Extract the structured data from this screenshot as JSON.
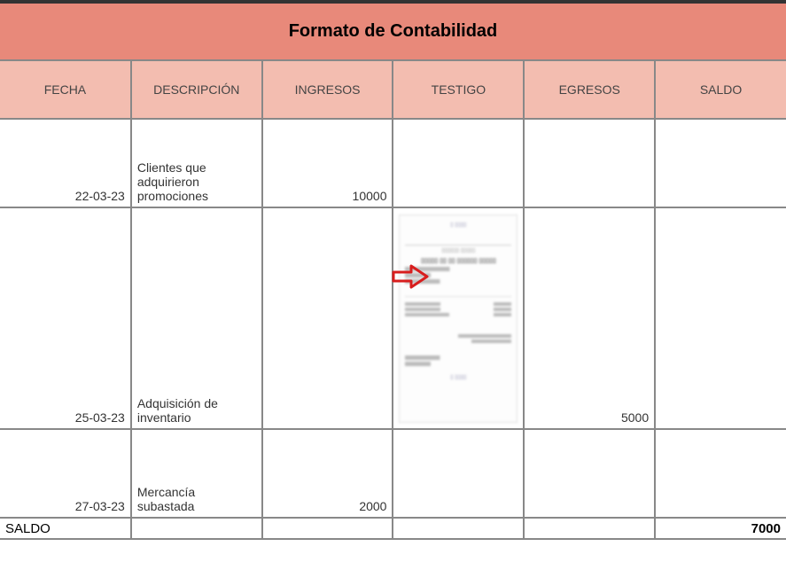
{
  "title": "Formato de Contabilidad",
  "headers": {
    "fecha": "FECHA",
    "descripcion": "DESCRIPCIÓN",
    "ingresos": "INGRESOS",
    "testigo": "TESTIGO",
    "egresos": "EGRESOS",
    "saldo": "SALDO"
  },
  "rows": [
    {
      "fecha": "22-03-23",
      "descripcion": "Clientes que adquirieron promociones",
      "ingresos": "10000",
      "testigo": "",
      "egresos": "",
      "saldo": ""
    },
    {
      "fecha": "25-03-23",
      "descripcion": "Adquisición de inventario",
      "ingresos": "",
      "testigo": "receipt",
      "egresos": "5000",
      "saldo": ""
    },
    {
      "fecha": "27-03-23",
      "descripcion": "Mercancía subastada",
      "ingresos": "2000",
      "testigo": "",
      "egresos": "",
      "saldo": ""
    }
  ],
  "footer": {
    "label": "SALDO",
    "total": "7000"
  }
}
